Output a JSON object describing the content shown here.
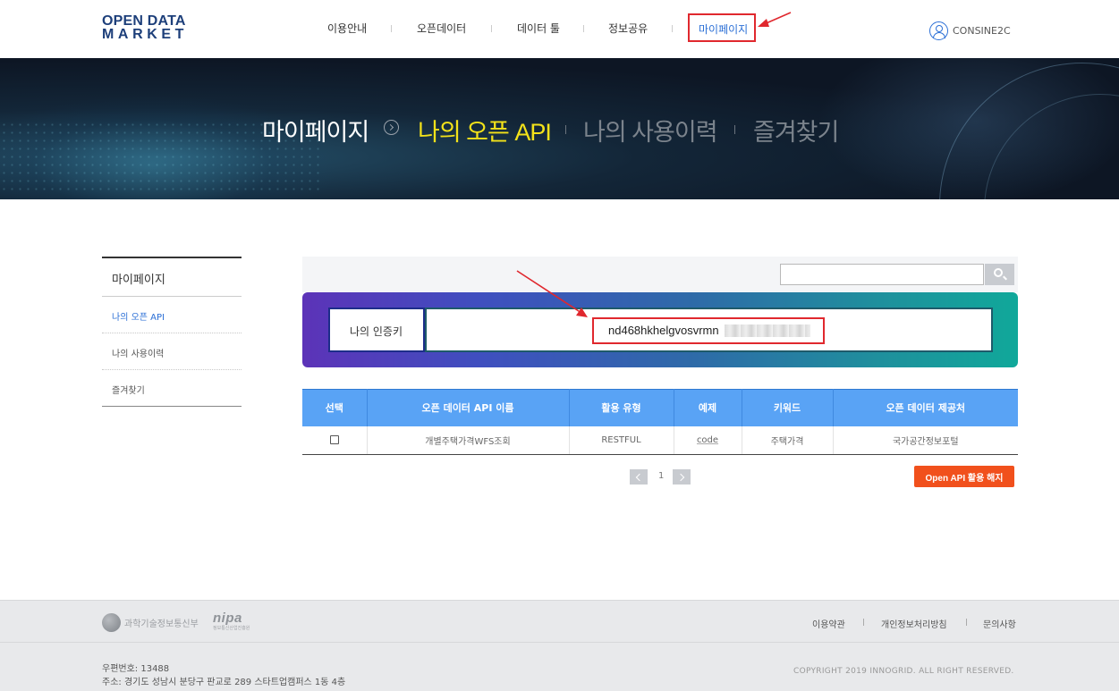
{
  "header": {
    "logo_line1": "OPEN DATA",
    "logo_line2": "MARKET",
    "nav": [
      "이용안내",
      "오픈데이터",
      "데이터 툴",
      "정보공유",
      "마이페이지"
    ],
    "user": "CONSINE2C"
  },
  "banner": {
    "home": "마이페이지",
    "active": "나의 오픈 API",
    "item2": "나의 사용이력",
    "item3": "즐겨찾기"
  },
  "sidebar": {
    "title": "마이페이지",
    "items": [
      "나의 오픈 API",
      "나의 사용이력",
      "즐겨찾기"
    ]
  },
  "search": {
    "value": "",
    "placeholder": ""
  },
  "auth_key": {
    "label": "나의 인증키",
    "value": "nd468hkhelgvosvrmn"
  },
  "table": {
    "headers": [
      "선택",
      "오픈 데이터 API 이름",
      "활용 유형",
      "예제",
      "키워드",
      "오픈 데이터 제공처"
    ],
    "rows": [
      {
        "name": "개별주택가격WFS조회",
        "type": "RESTFUL",
        "example": "code",
        "keyword": "주택가격",
        "provider": "국가공간정보포털"
      }
    ]
  },
  "pagination": {
    "current": "1"
  },
  "actions": {
    "cancel": "Open API 활용 해지"
  },
  "footer": {
    "ministry": "과학기술정보통신부",
    "nipa": "nipa",
    "nipa_sub": "정보통신산업진흥원",
    "links": [
      "이용약관",
      "개인정보처리방침",
      "문의사항"
    ],
    "postal": "우편번호: 13488",
    "address": "주소: 경기도 성남시 분당구 판교로 289 스타트업캠퍼스 1동 4층",
    "copyright": "COPYRIGHT 2019 INNOGRID. ALL RIGHT RESERVED."
  },
  "colors": {
    "accent": "#2b6fd6",
    "highlight": "#e0282e",
    "banner_active": "#f3e21a",
    "table_header": "#59a3f5",
    "cancel_button": "#f1501c"
  }
}
